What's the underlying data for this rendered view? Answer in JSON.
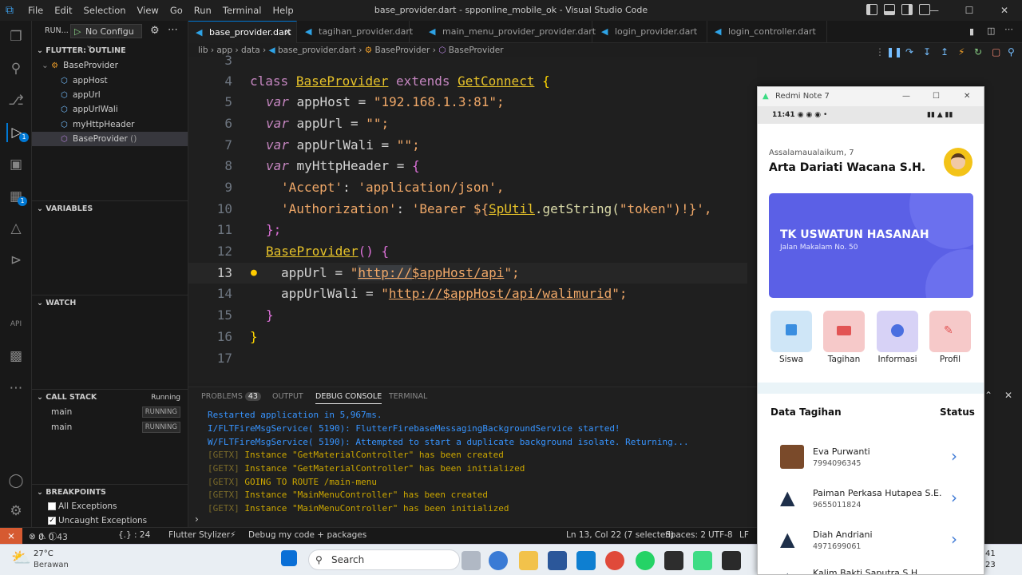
{
  "window": {
    "title": "base_provider.dart - spponline_mobile_ok - Visual Studio Code",
    "menu": [
      "File",
      "Edit",
      "Selection",
      "View",
      "Go",
      "Run",
      "Terminal",
      "Help"
    ]
  },
  "debug_toolbar": {
    "run_label": "RUN...",
    "config": "No Configu"
  },
  "sidebar": {
    "outline_header": "FLUTTER: OUTLINE",
    "outline": [
      {
        "label": "BaseProvider"
      },
      {
        "label": "appHost"
      },
      {
        "label": "appUrl"
      },
      {
        "label": "appUrlWali"
      },
      {
        "label": "myHttpHeader"
      },
      {
        "label": "BaseProvider",
        "suffix": "()"
      }
    ],
    "variables_header": "VARIABLES",
    "watch_header": "WATCH",
    "callstack_header": "CALL STACK",
    "callstack_status": "Running",
    "callstack": [
      {
        "name": "main",
        "state": "RUNNING"
      },
      {
        "name": "main",
        "state": "RUNNING"
      }
    ],
    "breakpoints_header": "BREAKPOINTS",
    "breakpoints": [
      {
        "label": "All Exceptions",
        "checked": false
      },
      {
        "label": "Uncaught Exceptions",
        "checked": true
      }
    ]
  },
  "tabs": [
    {
      "label": "base_provider.dart",
      "active": true
    },
    {
      "label": "tagihan_provider.dart"
    },
    {
      "label": "main_menu_provider_provider.dart"
    },
    {
      "label": "login_provider.dart"
    },
    {
      "label": "login_controller.dart"
    }
  ],
  "breadcrumb": [
    "lib",
    "app",
    "data",
    "base_provider.dart",
    "BaseProvider",
    "BaseProvider"
  ],
  "code": {
    "line_numbers": [
      "3",
      "4",
      "5",
      "6",
      "7",
      "8",
      "9",
      "10",
      "11",
      "12",
      "13",
      "14",
      "15",
      "16",
      "17"
    ],
    "l4": {
      "kw": "class",
      "cls": "BaseProvider",
      "ext": "extends",
      "base": "GetConnect",
      "br": "{"
    },
    "l5": {
      "kw": "var",
      "name": "appHost",
      "eq": "=",
      "str": "\"192.168.1.3:81\";"
    },
    "l6": {
      "kw": "var",
      "name": "appUrl",
      "eq": "=",
      "str": "\"\";"
    },
    "l7": {
      "kw": "var",
      "name": "appUrlWali",
      "eq": "=",
      "str": "\"\";"
    },
    "l8": {
      "kw": "var",
      "name": "myHttpHeader",
      "eq": "=",
      "br": "{"
    },
    "l9": {
      "k": "'Accept'",
      "colon": ":",
      "v": "'application/json',"
    },
    "l10": {
      "k": "'Authorization'",
      "colon": ":",
      "v1": "'Bearer ${",
      "cls": "SpUtil",
      "fn": ".getString(",
      "arg": "\"token\"",
      "v2": ")!}',"
    },
    "l11": {
      "txt": "};"
    },
    "l12": {
      "fn": "BaseProvider",
      "rest": "() {"
    },
    "l13": {
      "name": "appUrl",
      "eq": "=",
      "q": "\"",
      "url1": "http://",
      "url2": "$appHost/api",
      "end": "\";"
    },
    "l14": {
      "name": "appUrlWali",
      "eq": "=",
      "q": "\"",
      "url1": "http://",
      "url2": "$appHost/api/walimurid",
      "end": "\";"
    },
    "l15": {
      "txt": "}"
    },
    "l16": {
      "txt": "}"
    }
  },
  "panel": {
    "tabs": [
      "PROBLEMS",
      "OUTPUT",
      "DEBUG CONSOLE",
      "TERMINAL"
    ],
    "problems_count": "43",
    "logs": [
      {
        "text": "Restarted application in 5,967ms.",
        "color": "#3794ff"
      },
      {
        "text": "I/FLTFireMsgService( 5190): FlutterFirebaseMessagingBackgroundService started!",
        "color": "#3794ff"
      },
      {
        "text": "W/FLTFireMsgService( 5190): Attempted to start a duplicate background isolate. Returning...",
        "color": "#3794ff"
      },
      {
        "tag": "[GETX]",
        "text": " Instance \"GetMaterialController\" has been created",
        "color": "#cca700"
      },
      {
        "tag": "[GETX]",
        "text": " Instance \"GetMaterialController\" has been initialized",
        "color": "#cca700"
      },
      {
        "tag": "[GETX]",
        "text": " GOING TO ROUTE /main-menu",
        "color": "#cca700"
      },
      {
        "tag": "[GETX]",
        "text": " Instance \"MainMenuController\" has been created",
        "color": "#cca700"
      },
      {
        "tag": "[GETX]",
        "text": " Instance \"MainMenuController\" has been initialized",
        "color": "#cca700"
      }
    ]
  },
  "statusbar": {
    "errors": "0",
    "warnings": "0",
    "info": "43",
    "sel": "{.} : 24",
    "stylizer": "Flutter Stylizer",
    "debug": "Debug my code + packages",
    "position": "Ln 13, Col 22 (7 selected)",
    "spaces": "Spaces: 2",
    "enc": "UTF-8",
    "eol": "LF"
  },
  "taskbar": {
    "temp": "27°C",
    "weather": "Berawan",
    "search": "Search",
    "clock1": "41",
    "clock2": "23"
  },
  "phone": {
    "window_title": "Redmi Note 7",
    "status_time": "11:41",
    "greeting": "Assalamaualaikum, 7",
    "name": "Arta Dariati Wacana S.H.",
    "school": "TK USWATUN HASANAH",
    "address": "Jalan Makalam No. 50",
    "menu": [
      {
        "label": "Siswa",
        "bg": "#cfe6f7",
        "icon": "#3a8ee0"
      },
      {
        "label": "Tagihan",
        "bg": "#f6c9c9",
        "icon": "#e25454"
      },
      {
        "label": "Informasi",
        "bg": "#d7d2f6",
        "icon": "#4a6fe0"
      },
      {
        "label": "Profil",
        "bg": "#f6c9c9",
        "icon": "#e25454"
      }
    ],
    "data_title": "Data Tagihan",
    "status_title": "Status",
    "rows": [
      {
        "name": "Eva Purwanti",
        "id": "7994096345"
      },
      {
        "name": "Paiman Perkasa Hutapea S.E.",
        "id": "9655011824"
      },
      {
        "name": "Diah Andriani",
        "id": "4971699061"
      },
      {
        "name": "Kalim Bakti Saputra S.H.",
        "id": ""
      }
    ]
  }
}
